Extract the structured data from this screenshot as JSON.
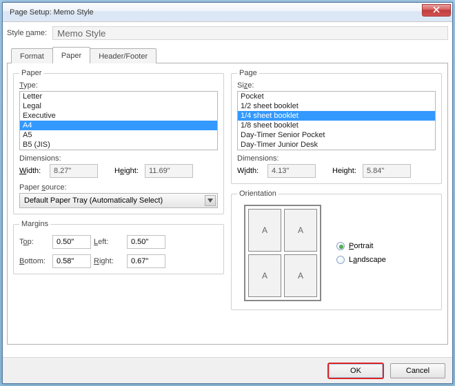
{
  "window": {
    "title": "Page Setup: Memo Style"
  },
  "style_name": {
    "label": "Style name:",
    "value": "Memo Style"
  },
  "tabs": [
    {
      "label": "Format",
      "active": false
    },
    {
      "label": "Paper",
      "active": true
    },
    {
      "label": "Header/Footer",
      "active": false
    }
  ],
  "paper": {
    "legend": "Paper",
    "type_label": "Type:",
    "options": [
      "Letter",
      "Legal",
      "Executive",
      "A4",
      "A5",
      "B5 (JIS)"
    ],
    "selected": "A4",
    "dimensions_label": "Dimensions:",
    "width_label": "Width:",
    "height_label": "Height:",
    "width": "8.27\"",
    "height": "11.69\"",
    "source_label": "Paper source:",
    "source_value": "Default Paper Tray (Automatically Select)"
  },
  "margins": {
    "legend": "Margins",
    "top_label": "Top:",
    "bottom_label": "Bottom:",
    "left_label": "Left:",
    "right_label": "Right:",
    "top": "0.50\"",
    "bottom": "0.58\"",
    "left": "0.50\"",
    "right": "0.67\""
  },
  "page": {
    "legend": "Page",
    "size_label": "Size:",
    "options": [
      "Pocket",
      "1/2 sheet booklet",
      "1/4 sheet booklet",
      "1/8 sheet booklet",
      "Day-Timer Senior Pocket",
      "Day-Timer Junior Desk"
    ],
    "selected": "1/4 sheet booklet",
    "dimensions_label": "Dimensions:",
    "width_label": "Width:",
    "height_label": "Height:",
    "width": "4.13\"",
    "height": "5.84\""
  },
  "orientation": {
    "legend": "Orientation",
    "preview_glyph": "A",
    "portrait_label": "Portrait",
    "landscape_label": "Landscape",
    "selected": "portrait"
  },
  "buttons": {
    "ok": "OK",
    "cancel": "Cancel"
  }
}
